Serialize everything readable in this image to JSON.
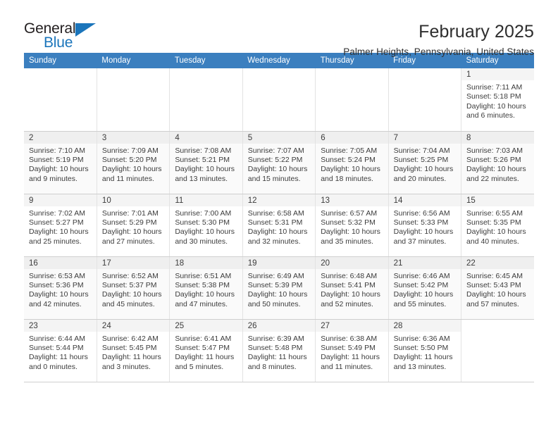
{
  "brand": {
    "name_top": "General",
    "name_bottom": "Blue",
    "colors": {
      "blue": "#1b75bb",
      "dark": "#231f20"
    }
  },
  "header": {
    "title": "February 2025",
    "subtitle": "Palmer Heights, Pennsylvania, United States"
  },
  "theme": {
    "header_row_bg": "#3b7fbf",
    "header_row_text": "#ffffff",
    "daynum_bg": "#f4f4f4",
    "alt_row_bg": "#fafafa",
    "body_text": "#3c3c3c"
  },
  "weekday_headers": [
    "Sunday",
    "Monday",
    "Tuesday",
    "Wednesday",
    "Thursday",
    "Friday",
    "Saturday"
  ],
  "labels": {
    "sunrise": "Sunrise:",
    "sunset": "Sunset:",
    "daylight": "Daylight:"
  },
  "weeks": [
    [
      {
        "empty": true
      },
      {
        "empty": true
      },
      {
        "empty": true
      },
      {
        "empty": true
      },
      {
        "empty": true
      },
      {
        "empty": true
      },
      {
        "day": "1",
        "sunrise": "Sunrise: 7:11 AM",
        "sunset": "Sunset: 5:18 PM",
        "daylight": "Daylight: 10 hours and 6 minutes."
      }
    ],
    [
      {
        "day": "2",
        "sunrise": "Sunrise: 7:10 AM",
        "sunset": "Sunset: 5:19 PM",
        "daylight": "Daylight: 10 hours and 9 minutes."
      },
      {
        "day": "3",
        "sunrise": "Sunrise: 7:09 AM",
        "sunset": "Sunset: 5:20 PM",
        "daylight": "Daylight: 10 hours and 11 minutes."
      },
      {
        "day": "4",
        "sunrise": "Sunrise: 7:08 AM",
        "sunset": "Sunset: 5:21 PM",
        "daylight": "Daylight: 10 hours and 13 minutes."
      },
      {
        "day": "5",
        "sunrise": "Sunrise: 7:07 AM",
        "sunset": "Sunset: 5:22 PM",
        "daylight": "Daylight: 10 hours and 15 minutes."
      },
      {
        "day": "6",
        "sunrise": "Sunrise: 7:05 AM",
        "sunset": "Sunset: 5:24 PM",
        "daylight": "Daylight: 10 hours and 18 minutes."
      },
      {
        "day": "7",
        "sunrise": "Sunrise: 7:04 AM",
        "sunset": "Sunset: 5:25 PM",
        "daylight": "Daylight: 10 hours and 20 minutes."
      },
      {
        "day": "8",
        "sunrise": "Sunrise: 7:03 AM",
        "sunset": "Sunset: 5:26 PM",
        "daylight": "Daylight: 10 hours and 22 minutes."
      }
    ],
    [
      {
        "day": "9",
        "sunrise": "Sunrise: 7:02 AM",
        "sunset": "Sunset: 5:27 PM",
        "daylight": "Daylight: 10 hours and 25 minutes."
      },
      {
        "day": "10",
        "sunrise": "Sunrise: 7:01 AM",
        "sunset": "Sunset: 5:29 PM",
        "daylight": "Daylight: 10 hours and 27 minutes."
      },
      {
        "day": "11",
        "sunrise": "Sunrise: 7:00 AM",
        "sunset": "Sunset: 5:30 PM",
        "daylight": "Daylight: 10 hours and 30 minutes."
      },
      {
        "day": "12",
        "sunrise": "Sunrise: 6:58 AM",
        "sunset": "Sunset: 5:31 PM",
        "daylight": "Daylight: 10 hours and 32 minutes."
      },
      {
        "day": "13",
        "sunrise": "Sunrise: 6:57 AM",
        "sunset": "Sunset: 5:32 PM",
        "daylight": "Daylight: 10 hours and 35 minutes."
      },
      {
        "day": "14",
        "sunrise": "Sunrise: 6:56 AM",
        "sunset": "Sunset: 5:33 PM",
        "daylight": "Daylight: 10 hours and 37 minutes."
      },
      {
        "day": "15",
        "sunrise": "Sunrise: 6:55 AM",
        "sunset": "Sunset: 5:35 PM",
        "daylight": "Daylight: 10 hours and 40 minutes."
      }
    ],
    [
      {
        "day": "16",
        "sunrise": "Sunrise: 6:53 AM",
        "sunset": "Sunset: 5:36 PM",
        "daylight": "Daylight: 10 hours and 42 minutes."
      },
      {
        "day": "17",
        "sunrise": "Sunrise: 6:52 AM",
        "sunset": "Sunset: 5:37 PM",
        "daylight": "Daylight: 10 hours and 45 minutes."
      },
      {
        "day": "18",
        "sunrise": "Sunrise: 6:51 AM",
        "sunset": "Sunset: 5:38 PM",
        "daylight": "Daylight: 10 hours and 47 minutes."
      },
      {
        "day": "19",
        "sunrise": "Sunrise: 6:49 AM",
        "sunset": "Sunset: 5:39 PM",
        "daylight": "Daylight: 10 hours and 50 minutes."
      },
      {
        "day": "20",
        "sunrise": "Sunrise: 6:48 AM",
        "sunset": "Sunset: 5:41 PM",
        "daylight": "Daylight: 10 hours and 52 minutes."
      },
      {
        "day": "21",
        "sunrise": "Sunrise: 6:46 AM",
        "sunset": "Sunset: 5:42 PM",
        "daylight": "Daylight: 10 hours and 55 minutes."
      },
      {
        "day": "22",
        "sunrise": "Sunrise: 6:45 AM",
        "sunset": "Sunset: 5:43 PM",
        "daylight": "Daylight: 10 hours and 57 minutes."
      }
    ],
    [
      {
        "day": "23",
        "sunrise": "Sunrise: 6:44 AM",
        "sunset": "Sunset: 5:44 PM",
        "daylight": "Daylight: 11 hours and 0 minutes."
      },
      {
        "day": "24",
        "sunrise": "Sunrise: 6:42 AM",
        "sunset": "Sunset: 5:45 PM",
        "daylight": "Daylight: 11 hours and 3 minutes."
      },
      {
        "day": "25",
        "sunrise": "Sunrise: 6:41 AM",
        "sunset": "Sunset: 5:47 PM",
        "daylight": "Daylight: 11 hours and 5 minutes."
      },
      {
        "day": "26",
        "sunrise": "Sunrise: 6:39 AM",
        "sunset": "Sunset: 5:48 PM",
        "daylight": "Daylight: 11 hours and 8 minutes."
      },
      {
        "day": "27",
        "sunrise": "Sunrise: 6:38 AM",
        "sunset": "Sunset: 5:49 PM",
        "daylight": "Daylight: 11 hours and 11 minutes."
      },
      {
        "day": "28",
        "sunrise": "Sunrise: 6:36 AM",
        "sunset": "Sunset: 5:50 PM",
        "daylight": "Daylight: 11 hours and 13 minutes."
      },
      {
        "empty": true
      }
    ]
  ]
}
